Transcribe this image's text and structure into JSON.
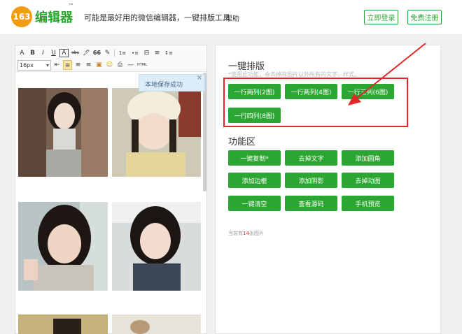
{
  "header": {
    "logo_number": "163",
    "logo_name": "编辑器",
    "logo_tm": "™",
    "tagline": "可能是最好用的微信编辑器，一键排版工具",
    "help": "帮助",
    "login_button": "立即登录",
    "register_button": "免费注册"
  },
  "editor": {
    "toolbar_row1": [
      "A",
      "B",
      "I",
      "U",
      "A",
      "abc",
      "🖊",
      "66",
      "✎",
      "1≡",
      "•≡",
      "⊟",
      "≡",
      "↕≡"
    ],
    "font_size": "16px",
    "toolbar_row2": [
      "⇤",
      "≡",
      "≡",
      "≡",
      "▣",
      "☺",
      "⎙",
      "—",
      "HTML"
    ],
    "toast": "本地保存成功",
    "toast_close": "×"
  },
  "panel": {
    "layout_title": "一键排版",
    "layout_note": "*使用此功能，会去掉除图片以外所有的文字，样式。",
    "layout_buttons": [
      "一行两列(2图)",
      "一行两列(4图)",
      "一行三列(6图)",
      "一行四列(8图)"
    ],
    "function_title": "功能区",
    "function_buttons": [
      "一键复制*",
      "去掉文字",
      "添加圆角",
      "添加边框",
      "添加阴影",
      "去掉动图",
      "一键清空",
      "查看源码",
      "手机预览"
    ],
    "count_prefix": "当前有",
    "count_number": "14",
    "count_suffix": "张图片"
  },
  "colors": {
    "brand_green": "#2ca632",
    "highlight_red": "#e02828",
    "logo_orange": "#f39c12"
  }
}
